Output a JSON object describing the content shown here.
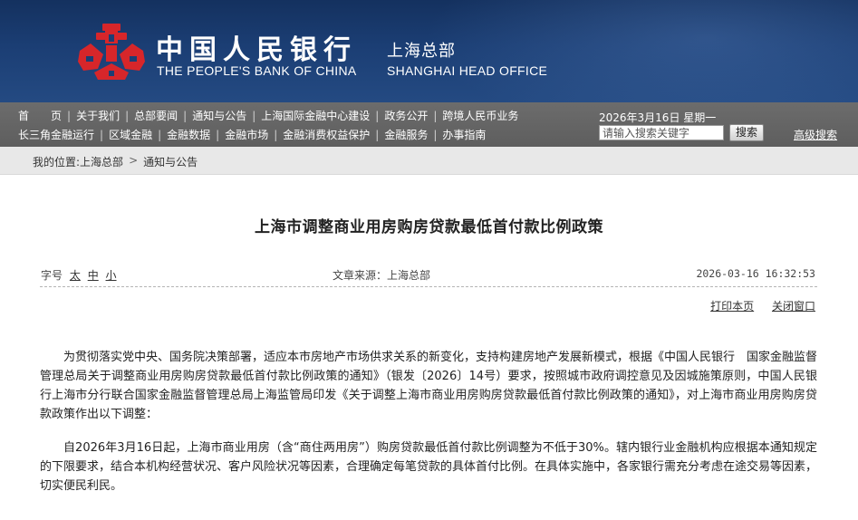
{
  "header": {
    "title_cn": "中国人民银行",
    "title_en": "THE PEOPLE'S BANK OF CHINA",
    "branch_cn": "上海总部",
    "branch_en": "SHANGHAI HEAD OFFICE",
    "logo_icon": "pboc-logo-icon",
    "logo_color": "#d7262a",
    "banner_color": "#1b3e74"
  },
  "nav": {
    "row1": [
      "首　　页",
      "关于我们",
      "总部要闻",
      "通知与公告",
      "上海国际金融中心建设",
      "政务公开",
      "跨境人民币业务"
    ],
    "row2": [
      "长三角金融运行",
      "区域金融",
      "金融数据",
      "金融市场",
      "金融消费权益保护",
      "金融服务",
      "办事指南"
    ],
    "date": "2026年3月16日  星期一",
    "search_placeholder": "请输入搜索关键字",
    "search_button": "搜索",
    "advanced_search": "高级搜索"
  },
  "breadcrumb": {
    "prefix": "我的位置:",
    "items": [
      "上海总部",
      "通知与公告"
    ],
    "separator": ">"
  },
  "article": {
    "title": "上海市调整商业用房购房贷款最低首付款比例政策",
    "font_size_label": "字号",
    "font_sizes": [
      "太",
      "中",
      "小"
    ],
    "source": "文章来源：上海总部",
    "timestamp": "2026-03-16  16:32:53",
    "print_link": "打印本页",
    "close_link": "关闭窗口",
    "paragraphs": [
      "为贯彻落实党中央、国务院决策部署，适应本市房地产市场供求关系的新变化，支持构建房地产发展新模式，根据《中国人民银行　国家金融监督管理总局关于调整商业用房购房贷款最低首付款比例政策的通知》（银发〔2026〕14号）要求，按照城市政府调控意见及因城施策原则，中国人民银行上海市分行联合国家金融监督管理总局上海监管局印发《关于调整上海市商业用房购房贷款最低首付款比例政策的通知》，对上海市商业用房购房贷款政策作出以下调整：",
      "自2026年3月16日起，上海市商业用房（含“商住两用房”）购房贷款最低首付款比例调整为不低于30%。辖内银行业金融机构应根据本通知规定的下限要求，结合本机构经营状况、客户风险状况等因素，合理确定每笔贷款的具体首付比例。在具体实施中，各家银行需充分考虑在途交易等因素，切实便民利民。"
    ]
  }
}
